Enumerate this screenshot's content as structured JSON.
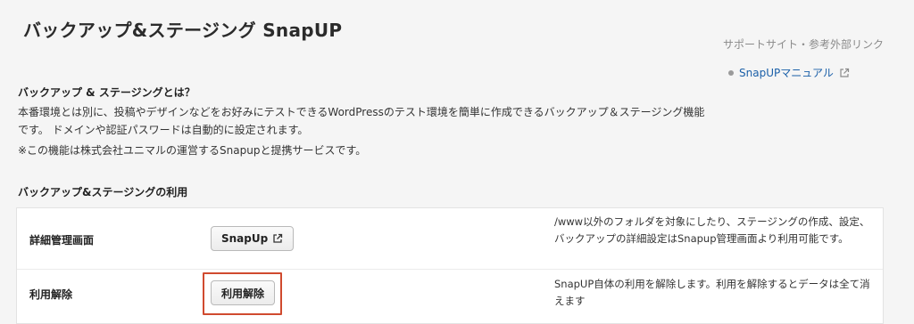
{
  "page": {
    "title": "バックアップ&ステージング SnapUP"
  },
  "support": {
    "heading": "サポートサイト・参考外部リンク",
    "links": [
      {
        "label": "SnapUPマニュアル",
        "icon": "external-link-icon"
      }
    ]
  },
  "about": {
    "title": "バックアップ & ステージングとは？",
    "description": "本番環境とは別に、投稿やデザインなどをお好みにテストできるWordPressのテスト環境を簡単に作成できるバックアップ＆ステージング機能です。 ドメインや認証パスワードは自動的に設定されます。",
    "note": "※この機能は株式会社ユニマルの運営するSnapupと提携サービスです。"
  },
  "usage": {
    "title": "バックアップ&ステージングの利用",
    "rows": [
      {
        "label": "詳細管理画面",
        "button": "SnapUp",
        "button_icon": "external-link-icon",
        "description": "/www以外のフォルダを対象にしたり、ステージングの作成、設定、バックアップの詳細設定はSnapup管理画面より利用可能です。"
      },
      {
        "label": "利用解除",
        "button": "利用解除",
        "description": "SnapUP自体の利用を解除します。利用を解除するとデータは全て消えます"
      }
    ]
  },
  "colors": {
    "link": "#1a5fa8",
    "highlight_border": "#d04a2f",
    "background": "#f5f5f5"
  }
}
